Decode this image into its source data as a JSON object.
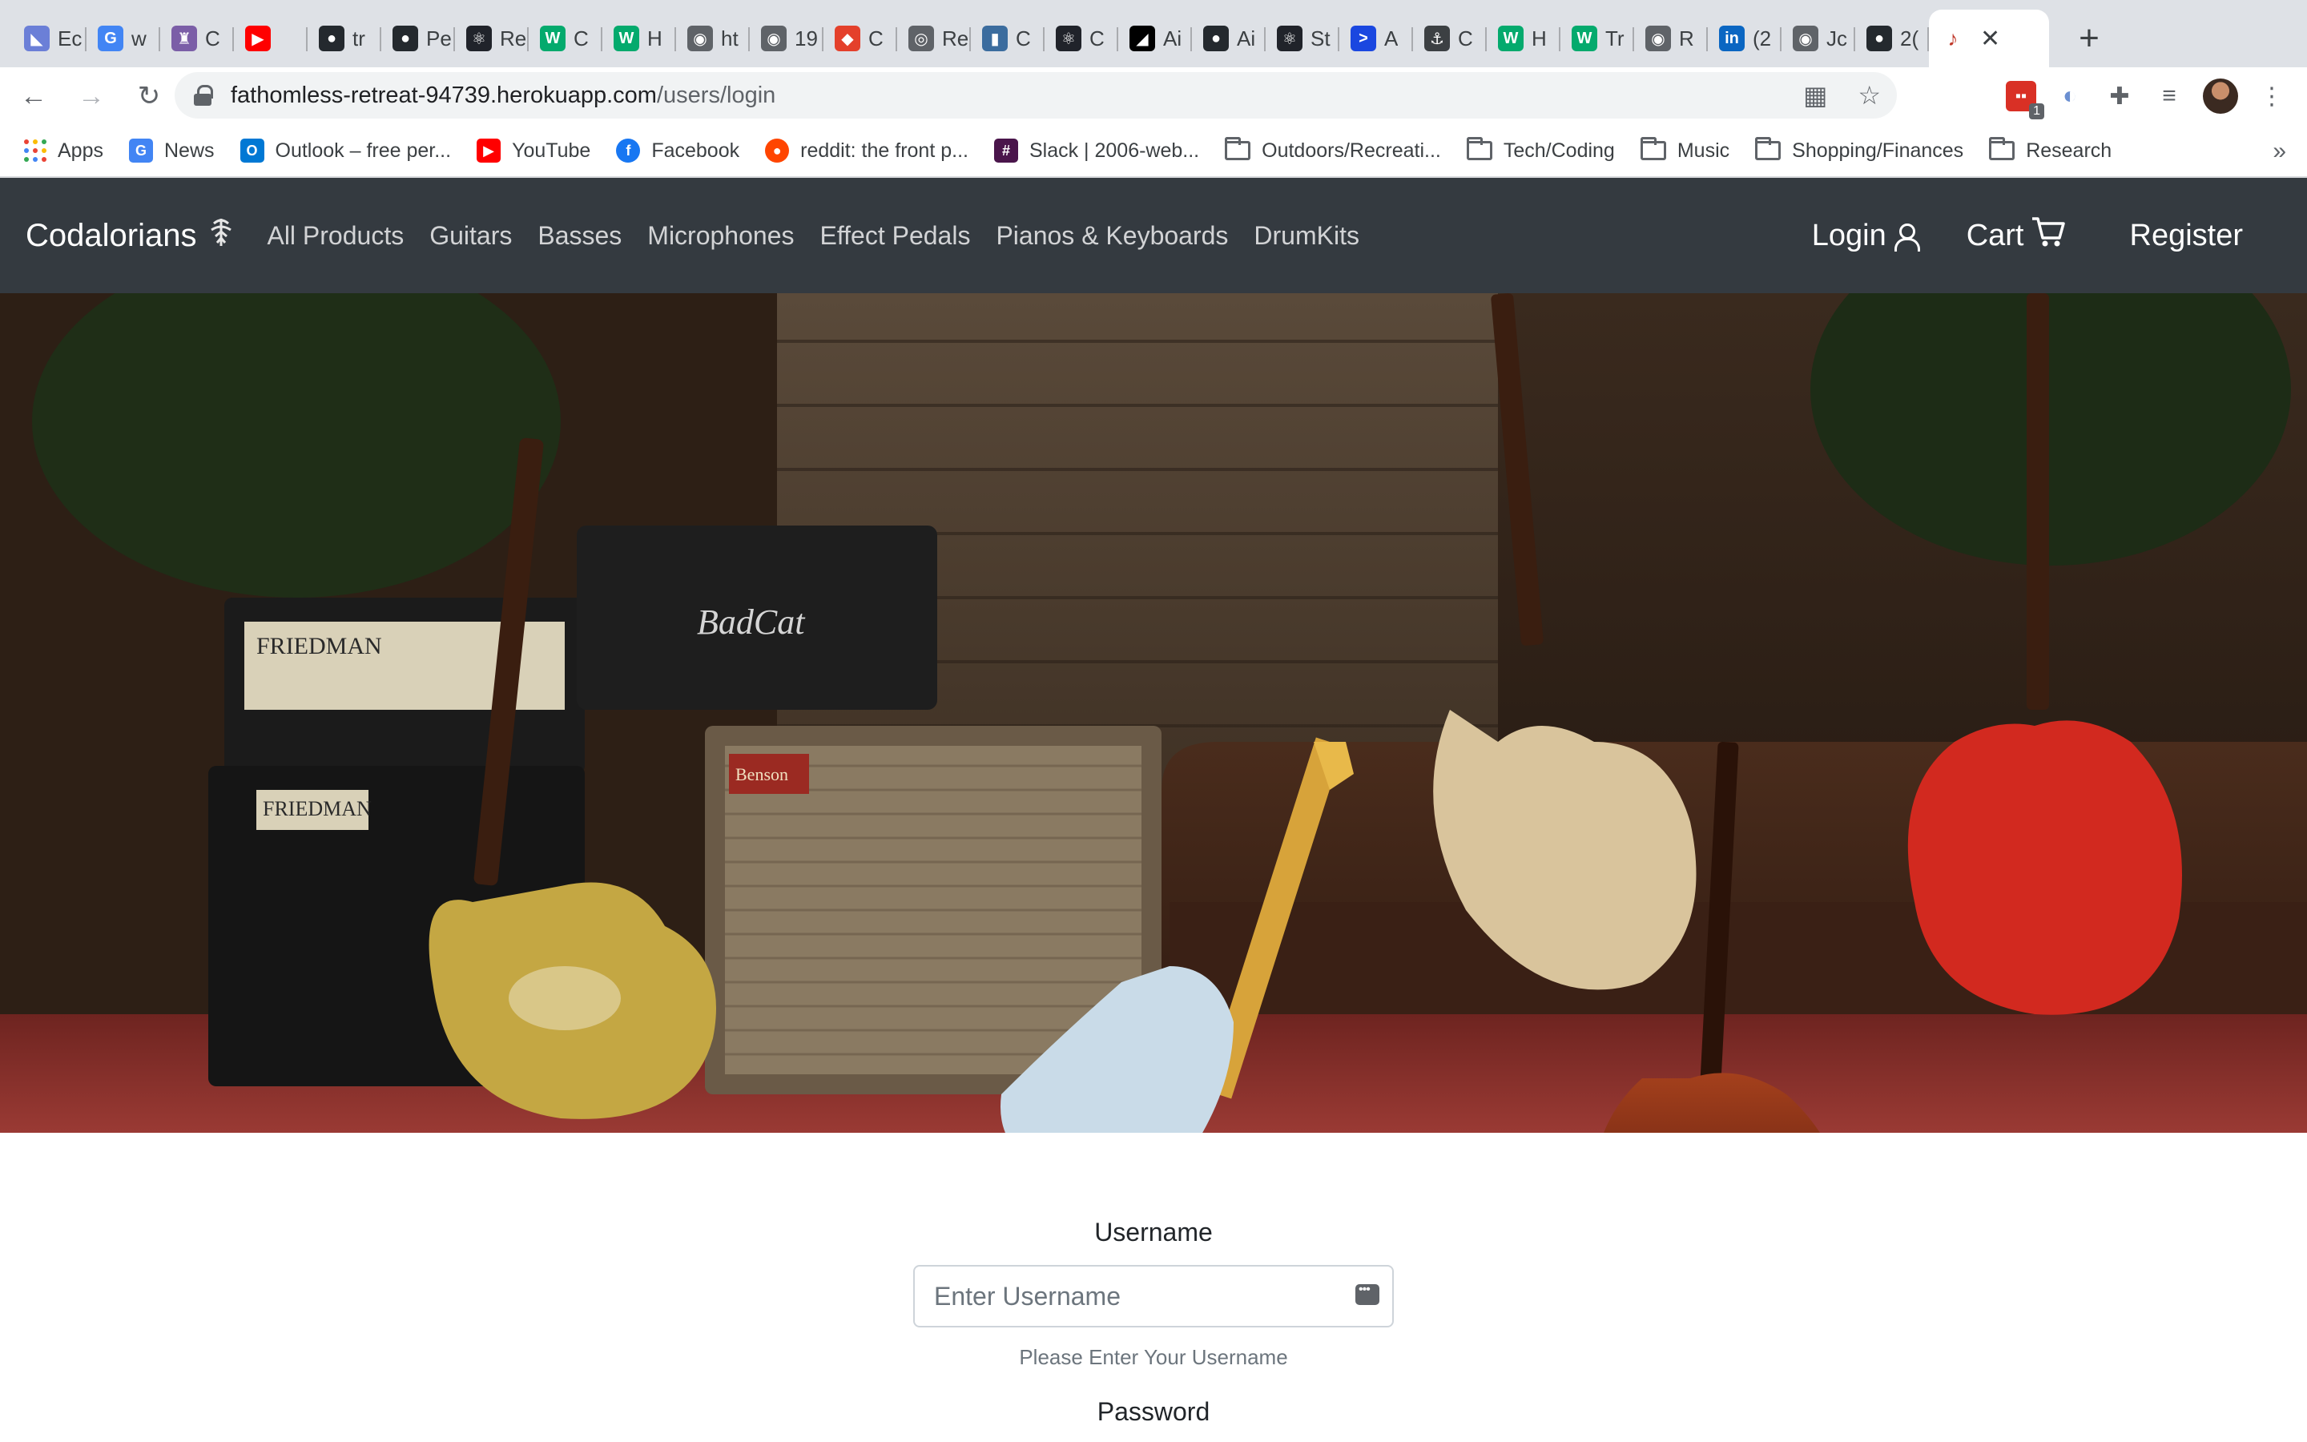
{
  "browser": {
    "tabs": [
      {
        "title": "Ec",
        "icon": "multicolor-app-icon",
        "color": "#6b7fd7"
      },
      {
        "title": "w",
        "icon": "google-icon",
        "color": "#4285f4"
      },
      {
        "title": "C",
        "icon": "castle-icon",
        "color": "#7b5ea7"
      },
      {
        "title": "",
        "icon": "youtube-icon",
        "color": "#ff0000"
      },
      {
        "title": "tr",
        "icon": "github-icon",
        "color": "#24292e"
      },
      {
        "title": "Pe",
        "icon": "github-icon",
        "color": "#24292e"
      },
      {
        "title": "Re",
        "icon": "react-icon",
        "color": "#20232a"
      },
      {
        "title": "C",
        "icon": "w3-icon",
        "color": "#04aa6d"
      },
      {
        "title": "H",
        "icon": "w3-icon",
        "color": "#04aa6d"
      },
      {
        "title": "ht",
        "icon": "globe-icon",
        "color": "#5f6368"
      },
      {
        "title": "19",
        "icon": "globe-icon",
        "color": "#5f6368"
      },
      {
        "title": "C",
        "icon": "diamond-icon",
        "color": "#e4402b"
      },
      {
        "title": "Re",
        "icon": "spiral-icon",
        "color": "#5f6368"
      },
      {
        "title": "C",
        "icon": "book-icon",
        "color": "#3b6c9e"
      },
      {
        "title": "C",
        "icon": "react-icon",
        "color": "#20232a"
      },
      {
        "title": "Ai",
        "icon": "bookmark-icon",
        "color": "#000000"
      },
      {
        "title": "Ai",
        "icon": "github-icon",
        "color": "#24292e"
      },
      {
        "title": "St",
        "icon": "react-icon",
        "color": "#20232a"
      },
      {
        "title": "A",
        "icon": "terminal-icon",
        "color": "#1a47e0"
      },
      {
        "title": "C",
        "icon": "anchor-icon",
        "color": "#3c4043"
      },
      {
        "title": "H",
        "icon": "w3-icon",
        "color": "#04aa6d"
      },
      {
        "title": "Tr",
        "icon": "w3-icon",
        "color": "#04aa6d"
      },
      {
        "title": "R",
        "icon": "globe-icon",
        "color": "#5f6368"
      },
      {
        "title": "(2",
        "icon": "linkedin-icon",
        "color": "#0a66c2"
      },
      {
        "title": "Jc",
        "icon": "globe-icon",
        "color": "#5f6368"
      },
      {
        "title": "2(",
        "icon": "github-icon",
        "color": "#24292e"
      }
    ],
    "active_tab": {
      "icon": "guitar-icon",
      "close": "✕"
    },
    "new_tab": "+",
    "url_host": "fathomless-retreat-94739.herokuapp.com",
    "url_path": "/users/login",
    "extension_badge": "1",
    "bookmarks": [
      {
        "label": "Apps",
        "icon": "apps-grid-icon"
      },
      {
        "label": "News",
        "icon": "google-news-icon",
        "color": "#4285f4"
      },
      {
        "label": "Outlook – free per...",
        "icon": "outlook-icon",
        "color": "#0078d4"
      },
      {
        "label": "YouTube",
        "icon": "youtube-icon",
        "color": "#ff0000"
      },
      {
        "label": "Facebook",
        "icon": "facebook-icon",
        "color": "#1877f2"
      },
      {
        "label": "reddit: the front p...",
        "icon": "reddit-icon",
        "color": "#ff4500"
      },
      {
        "label": "Slack | 2006-web...",
        "icon": "slack-icon",
        "color": "#4a154b"
      },
      {
        "label": "Outdoors/Recreati...",
        "icon": "folder-icon"
      },
      {
        "label": "Tech/Coding",
        "icon": "folder-icon"
      },
      {
        "label": "Music",
        "icon": "folder-icon"
      },
      {
        "label": "Shopping/Finances",
        "icon": "folder-icon"
      },
      {
        "label": "Research",
        "icon": "folder-icon"
      }
    ],
    "more_bookmarks": "»"
  },
  "site": {
    "brand": "Codalorians",
    "nav": [
      "All Products",
      "Guitars",
      "Basses",
      "Microphones",
      "Effect Pedals",
      "Pianos & Keyboards",
      "DrumKits"
    ],
    "login": "Login",
    "cart": "Cart",
    "register": "Register",
    "colors": {
      "navbar": "#343a40",
      "text": "#ffffff"
    }
  },
  "hero": {
    "amp_labels": [
      "FRIEDMAN",
      "FRIEDMAN",
      "BadCat",
      "Benson"
    ]
  },
  "form": {
    "username_label": "Username",
    "username_placeholder": "Enter Username",
    "username_help": "Please Enter Your Username",
    "password_label": "Password"
  }
}
